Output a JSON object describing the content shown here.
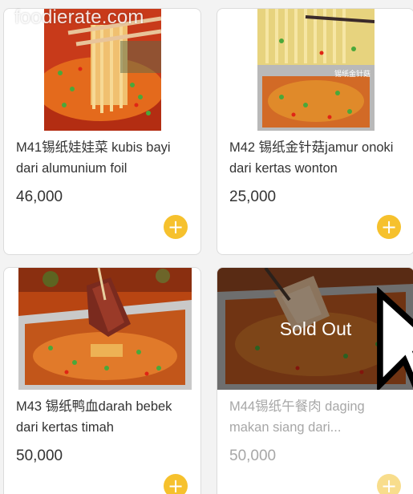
{
  "watermark": "foodierate.com",
  "products": [
    {
      "name": "M41锡纸娃娃菜 kubis bayi dari alumunium foil",
      "price": "46,000",
      "sold_out": false
    },
    {
      "name": "M42 锡纸金针菇jamur onoki dari kertas wonton",
      "price": "25,000",
      "sold_out": false,
      "image_caption": "锡纸金针菇"
    },
    {
      "name": "M43 锡纸鸭血darah bebek dari kertas timah",
      "price": "50,000",
      "sold_out": false
    },
    {
      "name": "M44锡纸午餐肉 daging makan siang dari...",
      "price": "50,000",
      "sold_out": true,
      "sold_out_label": "Sold Out"
    }
  ],
  "add_button_icon": "plus-icon",
  "colors": {
    "add_button": "#f6c12d",
    "add_button_disabled": "#f8dd8c",
    "text": "#333333",
    "text_disabled": "#a7a7a7"
  }
}
